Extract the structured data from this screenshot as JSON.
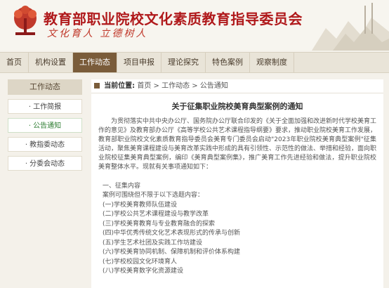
{
  "header": {
    "title": "教育部职业院校文化素质教育指导委员会",
    "slogan": "文化育人  立德树人"
  },
  "nav": [
    {
      "label": "首页"
    },
    {
      "label": "机构设置"
    },
    {
      "label": "工作动态"
    },
    {
      "label": "项目申报"
    },
    {
      "label": "理论探究"
    },
    {
      "label": "特色案例"
    },
    {
      "label": "观察制度"
    }
  ],
  "sidebar": {
    "title": "工作动态",
    "items": [
      {
        "label": "· 工作简报"
      },
      {
        "label": "· 公告通知"
      },
      {
        "label": "· 教指委动态"
      },
      {
        "label": "· 分委会动态"
      }
    ]
  },
  "breadcrumb": {
    "label": "当前位置:",
    "path": "首页 > 工作动态 > 公告通知"
  },
  "article": {
    "title": "关于征集职业院校美育典型案例的通知",
    "intro": "为贯彻落实中共中央办公厅、国务院办公厅联合印发的《关于全面加强和改进新时代学校美育工作的意见》及教育部办公厅《高等学校公共艺术课程指导纲要》要求，推动职业院校美育工作发展，教育部职业院校文化素质教育指导委员会美育专门委员会启动\"2023年职业院校美育典型案例\"征集活动，聚焦美育课程建设与美育改革实践中形成的具有引领性、示范性的做法、举措和经验，面向职业院校征集美育典型案例，编印《美育典型案例集》，推广美育工作先进经验和做法，提升职业院校美育整体水平。现就有关事项通知如下：",
    "section_title": "一、征集内容",
    "section_intro": "案例可围绕但不限于以下选题内容：",
    "list": [
      "(一)学校美育教师队伍建设",
      "(二)学校公共艺术课程建设与教学改革",
      "(三)学校美育教育与专业教育融合的探索",
      "(四)中华优秀传统文化艺术表现形式的传承与创新",
      "(五)学生艺术社团及实践工作坊建设",
      "(六)学校美育协同机制、保障机制和评价体系构建",
      "(七)学校校园文化环境育人",
      "(八)学校美育数字化资源建设"
    ]
  },
  "colors": {
    "brand_red": "#b0191b",
    "nav_active": "#7a5c3a",
    "sidebar_active": "#2e7d32"
  }
}
